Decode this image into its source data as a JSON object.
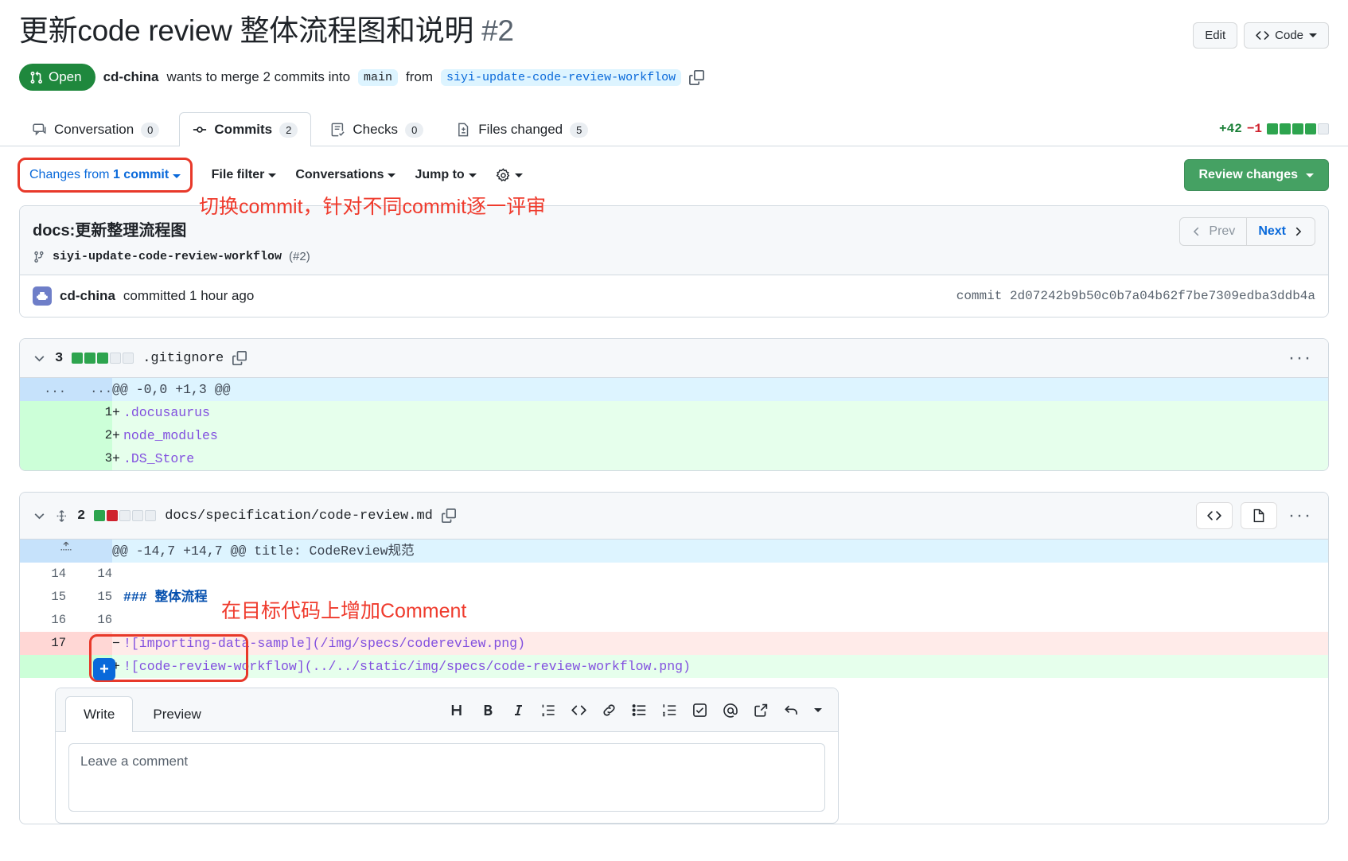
{
  "header": {
    "title": "更新code review 整体流程图和说明",
    "pr_number": "#2",
    "edit_label": "Edit",
    "code_label": "Code",
    "state": "Open",
    "author": "cd-china",
    "merge_text_1": "wants to merge 2 commits into",
    "base_branch": "main",
    "merge_text_2": "from",
    "head_branch": "siyi-update-code-review-workflow"
  },
  "tabs": [
    {
      "label": "Conversation",
      "count": "0",
      "icon": "comment-discussion-icon",
      "active": false
    },
    {
      "label": "Commits",
      "count": "2",
      "icon": "git-commit-icon",
      "active": true
    },
    {
      "label": "Checks",
      "count": "0",
      "icon": "checklist-icon",
      "active": false
    },
    {
      "label": "Files changed",
      "count": "5",
      "icon": "file-diff-icon",
      "active": false
    }
  ],
  "diffstat": {
    "additions": "+42",
    "deletions": "−1",
    "blocks": [
      "g",
      "g",
      "g",
      "g",
      "n"
    ]
  },
  "subtoolbar": {
    "changes_from_prefix": "Changes from",
    "changes_from_value": "1 commit",
    "file_filter": "File filter",
    "conversations": "Conversations",
    "jump_to": "Jump to",
    "settings_icon": "gear-icon",
    "review_changes": "Review changes"
  },
  "annotations": {
    "commit_switch": "切换commit，针对不同commit逐一评审",
    "add_comment": "在目标代码上增加Comment",
    "color": "#ef3b2d"
  },
  "commit_card": {
    "message": "docs:更新整理流程图",
    "branch": "siyi-update-code-review-workflow",
    "pr_ref": "(#2)",
    "prev_label": "Prev",
    "next_label": "Next",
    "author": "cd-china",
    "committed_text": "committed 1 hour ago",
    "commit_label": "commit",
    "commit_sha": "2d07242b9b50c0b7a04b62f7be7309edba3ddb4a"
  },
  "files": [
    {
      "name": ".gitignore",
      "change_count": "3",
      "blocks": [
        "g",
        "g",
        "g",
        "n",
        "n"
      ],
      "lines": [
        {
          "type": "hunk",
          "old": "...",
          "new": "...",
          "sign": "",
          "text": "@@ -0,0 +1,3 @@"
        },
        {
          "type": "add",
          "old": "",
          "new": "1",
          "sign": "+",
          "text": ".docusaurus"
        },
        {
          "type": "add",
          "old": "",
          "new": "2",
          "sign": "+",
          "text": "node_modules"
        },
        {
          "type": "add",
          "old": "",
          "new": "3",
          "sign": "+",
          "text": ".DS_Store"
        }
      ]
    },
    {
      "name": "docs/specification/code-review.md",
      "change_count": "2",
      "blocks": [
        "g",
        "r",
        "n",
        "n",
        "n"
      ],
      "lines": [
        {
          "type": "hunk",
          "old": "expand",
          "new": "",
          "sign": "",
          "text": "@@ -14,7 +14,7 @@ title: CodeReview规范"
        },
        {
          "type": "ctx",
          "old": "14",
          "new": "14",
          "sign": "",
          "text": ""
        },
        {
          "type": "ctx",
          "old": "15",
          "new": "15",
          "sign": "",
          "text": "### 整体流程"
        },
        {
          "type": "ctx",
          "old": "16",
          "new": "16",
          "sign": "",
          "text": ""
        },
        {
          "type": "del",
          "old": "17",
          "new": "",
          "sign": "−",
          "text": "![importing-data-sample](/img/specs/codereview.png)"
        },
        {
          "type": "add",
          "old": "",
          "new": "17",
          "sign": "+",
          "text": "![code-review-workflow](../../static/img/specs/code-review-workflow.png)"
        }
      ]
    }
  ],
  "comment_box": {
    "write_tab": "Write",
    "preview_tab": "Preview",
    "placeholder": "Leave a comment",
    "toolbar_icons": [
      "heading-icon",
      "bold-icon",
      "italic-icon",
      "numbered-list-icon",
      "code-icon",
      "link-icon",
      "bulleted-list-icon",
      "ordered-list-icon",
      "task-list-icon",
      "mention-icon",
      "cross-reference-icon",
      "reply-icon"
    ]
  }
}
